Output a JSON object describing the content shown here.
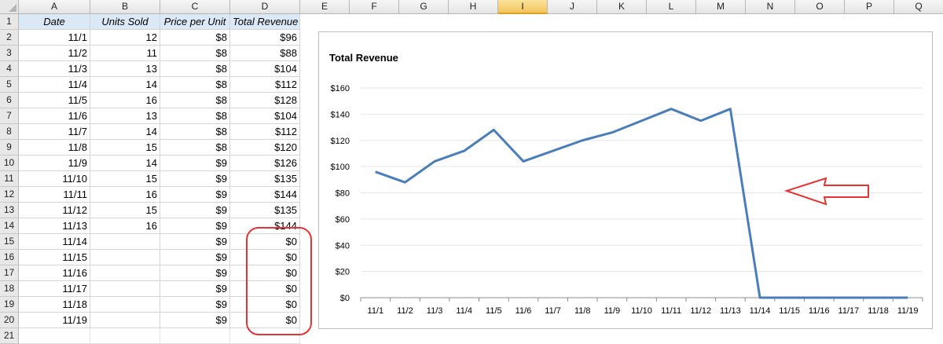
{
  "sheet": {
    "columns": [
      "A",
      "B",
      "C",
      "D",
      "E",
      "F",
      "G",
      "H",
      "I",
      "J",
      "K",
      "L",
      "M",
      "N",
      "O",
      "P",
      "Q"
    ],
    "selected_column": "I",
    "rows": [
      "1",
      "2",
      "3",
      "4",
      "5",
      "6",
      "7",
      "8",
      "9",
      "10",
      "11",
      "12",
      "13",
      "14",
      "15",
      "16",
      "17",
      "18",
      "19",
      "20",
      "21"
    ],
    "headers": [
      "Date",
      "Units Sold",
      "Price per Unit",
      "Total Revenue"
    ],
    "data": [
      [
        "11/1",
        "12",
        "$8",
        "$96"
      ],
      [
        "11/2",
        "11",
        "$8",
        "$88"
      ],
      [
        "11/3",
        "13",
        "$8",
        "$104"
      ],
      [
        "11/4",
        "14",
        "$8",
        "$112"
      ],
      [
        "11/5",
        "16",
        "$8",
        "$128"
      ],
      [
        "11/6",
        "13",
        "$8",
        "$104"
      ],
      [
        "11/7",
        "14",
        "$8",
        "$112"
      ],
      [
        "11/8",
        "15",
        "$8",
        "$120"
      ],
      [
        "11/9",
        "14",
        "$9",
        "$126"
      ],
      [
        "11/10",
        "15",
        "$9",
        "$135"
      ],
      [
        "11/11",
        "16",
        "$9",
        "$144"
      ],
      [
        "11/12",
        "15",
        "$9",
        "$135"
      ],
      [
        "11/13",
        "16",
        "$9",
        "$144"
      ],
      [
        "11/14",
        "",
        "$9",
        "$0"
      ],
      [
        "11/15",
        "",
        "$9",
        "$0"
      ],
      [
        "11/16",
        "",
        "$9",
        "$0"
      ],
      [
        "11/17",
        "",
        "$9",
        "$0"
      ],
      [
        "11/18",
        "",
        "$9",
        "$0"
      ],
      [
        "11/19",
        "",
        "$9",
        "$0"
      ]
    ]
  },
  "annotations": {
    "color": "#e53333"
  },
  "chart_data": {
    "type": "line",
    "title": "Total Revenue",
    "categories": [
      "11/1",
      "11/2",
      "11/3",
      "11/4",
      "11/5",
      "11/6",
      "11/7",
      "11/8",
      "11/9",
      "11/10",
      "11/11",
      "11/12",
      "11/13",
      "11/14",
      "11/15",
      "11/16",
      "11/17",
      "11/18",
      "11/19"
    ],
    "series": [
      {
        "values": [
          96,
          88,
          104,
          112,
          128,
          104,
          112,
          120,
          126,
          135,
          144,
          135,
          144,
          0,
          0,
          0,
          0,
          0,
          0
        ],
        "color": "#4a7ebb"
      }
    ],
    "ylim": [
      0,
      160
    ],
    "yticks": [
      0,
      20,
      40,
      60,
      80,
      100,
      120,
      140,
      160
    ],
    "ytick_labels": [
      "$0",
      "$20",
      "$40",
      "$60",
      "$80",
      "$100",
      "$120",
      "$140",
      "$160"
    ],
    "grid": true,
    "legend": "none"
  }
}
